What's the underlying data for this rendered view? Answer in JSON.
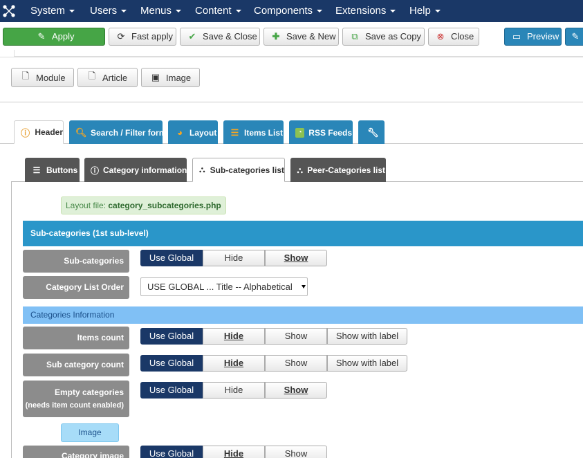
{
  "menu": {
    "items": [
      "System",
      "Users",
      "Menus",
      "Content",
      "Components",
      "Extensions",
      "Help"
    ]
  },
  "toolbar": {
    "apply": "Apply",
    "fast_apply": "Fast apply",
    "save_close": "Save & Close",
    "save_new": "Save & New",
    "save_copy": "Save as Copy",
    "close": "Close",
    "preview": "Preview"
  },
  "insert_buttons": {
    "module": "Module",
    "article": "Article",
    "image": "Image"
  },
  "main_tabs": [
    "Header",
    "Search / Filter form",
    "Layout",
    "Items List",
    "RSS Feeds"
  ],
  "sub_tabs": [
    "Buttons",
    "Category information",
    "Sub-categories list",
    "Peer-Categories list"
  ],
  "layout_note": {
    "prefix": "Layout file: ",
    "file": "category_subcategories.php"
  },
  "section_title": "Sub-categories (1st sub-level)",
  "subsection_title": "Categories Information",
  "image_button": "Image",
  "fields": {
    "subcategories": {
      "label": "Sub-categories",
      "options": [
        "Use Global",
        "Hide",
        "Show"
      ]
    },
    "order": {
      "label": "Category List Order",
      "value": "USE GLOBAL ... Title -- Alphabetical"
    },
    "items_count": {
      "label": "Items count",
      "options": [
        "Use Global",
        "Hide",
        "Show",
        "Show with label"
      ]
    },
    "subcat_count": {
      "label": "Sub category count",
      "options": [
        "Use Global",
        "Hide",
        "Show",
        "Show with label"
      ]
    },
    "empty_cats": {
      "label": "Empty categories",
      "note": "(needs item count enabled)",
      "options": [
        "Use Global",
        "Hide",
        "Show"
      ]
    },
    "cat_image": {
      "label": "Category image",
      "options": [
        "Use Global",
        "Hide",
        "Show"
      ]
    }
  },
  "colors": {
    "menubar": "#1a3867",
    "tab_blue": "#2a86b8",
    "section": "#2a96c9",
    "subsection": "#80c0f5",
    "selected": "#1a3867",
    "apply_green": "#46a546"
  }
}
